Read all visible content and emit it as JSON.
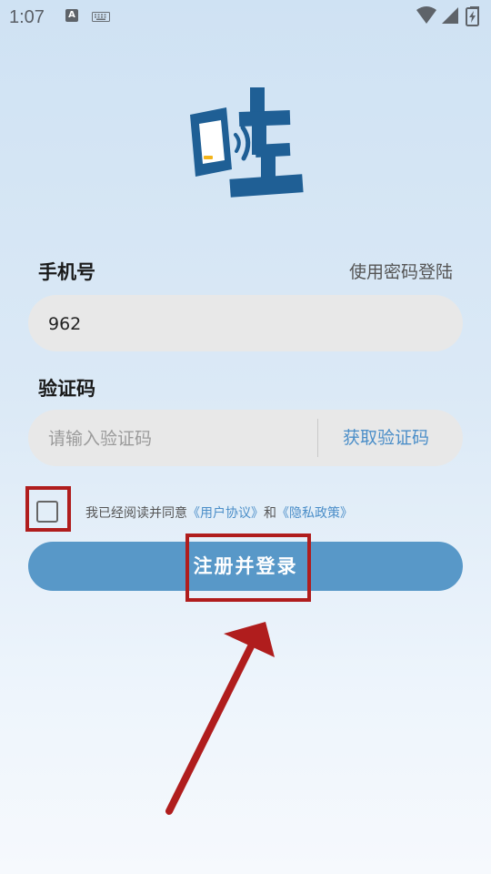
{
  "status_bar": {
    "time": "1:07",
    "notification_icons": [
      "a-icon",
      "keyboard-icon"
    ],
    "system_icons": [
      "wifi-icon",
      "signal-icon",
      "battery-charging-icon"
    ]
  },
  "logo": {
    "icon": "phone-nfc-logo"
  },
  "phone": {
    "label": "手机号",
    "value": "962"
  },
  "password_login_link": "使用密码登陆",
  "code": {
    "label": "验证码",
    "placeholder": "请输入验证码",
    "get_code_label": "获取验证码"
  },
  "agreement": {
    "checked": false,
    "prefix": "我已经阅读并同意",
    "user_agreement": "《用户协议》",
    "and": "和",
    "privacy_policy": "《隐私政策》"
  },
  "submit_label": "注册并登录",
  "colors": {
    "accent": "#5898c8",
    "link": "#4b8ec8",
    "annotation": "#b01d1d",
    "logo": "#1f5f95"
  }
}
